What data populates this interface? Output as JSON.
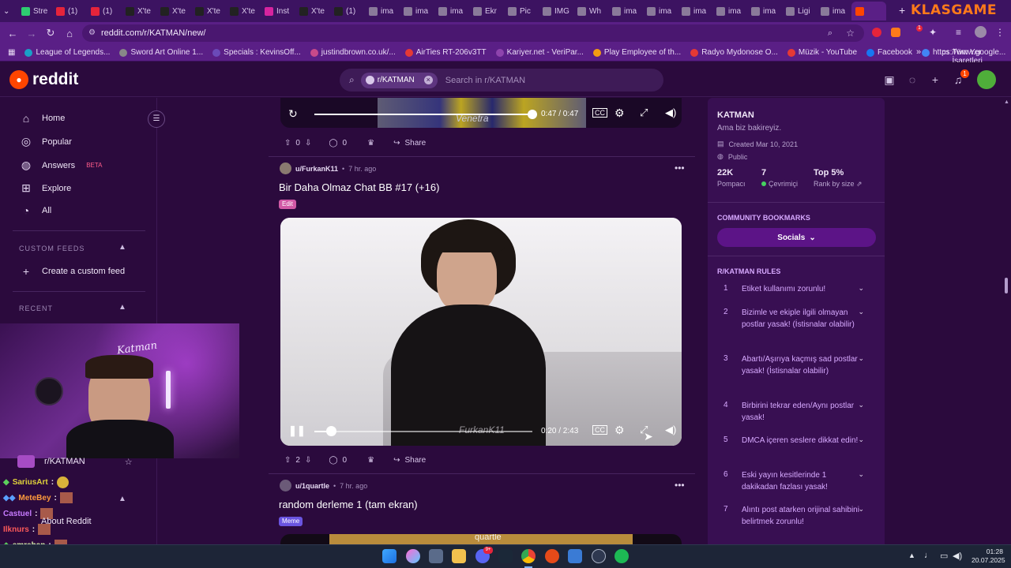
{
  "browser": {
    "tabs": [
      "Stre",
      "(1)",
      "(1)",
      "X'te",
      "X'te",
      "X'te",
      "X'te",
      "Inst",
      "X'te",
      "(1)",
      "ima",
      "ima",
      "ima",
      "Ekr",
      "Pic",
      "IMG",
      "Wh",
      "ima",
      "ima",
      "ima",
      "ima",
      "ima",
      "Ligi",
      "ima",
      ""
    ],
    "brand_text": "KLASGAME",
    "url": "reddit.com/r/KATMAN/new/",
    "bookmarks": [
      "League of Legends...",
      "Sword Art Online 1...",
      "Specials : KevinsOff...",
      "justindbrown.co.uk/...",
      "AirTies RT-206v3TT",
      "Kariyer.net - VeriPar...",
      "Play Employee of th...",
      "Radyo Mydonose O...",
      "Müzik - YouTube",
      "Facebook",
      "https://www.google..."
    ],
    "bookmarks_all": "Tüm Yer İşaretleri",
    "update_count": "1"
  },
  "reddit": {
    "logo_text": "reddit",
    "search_chip": "r/KATMAN",
    "search_placeholder": "Search in r/KATMAN",
    "notif_count": "1"
  },
  "leftnav": {
    "items": [
      {
        "label": "Home",
        "icon": "home-icon"
      },
      {
        "label": "Popular",
        "icon": "popular-icon"
      },
      {
        "label": "Answers",
        "icon": "answers-icon",
        "badge": "BETA"
      },
      {
        "label": "Explore",
        "icon": "explore-icon"
      },
      {
        "label": "All",
        "icon": "all-icon"
      }
    ],
    "custom_feeds_header": "CUSTOM FEEDS",
    "create_feed": "Create a custom feed",
    "recent_header": "RECENT",
    "recent_item": "r/KATMAN",
    "about": "About Reddit"
  },
  "overlay": {
    "cam_text": "Katman",
    "chat": [
      {
        "user": "SariusArt",
        "color": "#e0d23a"
      },
      {
        "user": "MeteBey",
        "color": "#ff9a3c"
      },
      {
        "user": "Castuel",
        "color": "#c77bff"
      },
      {
        "user": "Ilknurs",
        "color": "#ff5a5a"
      },
      {
        "user": "emrehan",
        "color": "#d6f0a8"
      }
    ]
  },
  "feed": {
    "prev_video": {
      "time": "0:47 / 0:47",
      "watermark": "Venetra",
      "progress": 1.0
    },
    "prev_actions": {
      "votes": "0",
      "comments": "0",
      "share": "Share"
    },
    "post1": {
      "author": "u/FurkanK11",
      "age": "7 hr. ago",
      "title": "Bir Daha Olmaz Chat BB #17 (+16)",
      "flair": "Edit",
      "video_time": "0:20 / 2:43",
      "video_watermark": "FurkanK11",
      "progress": 0.075,
      "votes": "2",
      "comments": "0",
      "share": "Share"
    },
    "post2": {
      "author": "u/1quartle",
      "age": "7 hr. ago",
      "title": "random derleme 1 (tam ekran)",
      "flair": "Meme",
      "video_watermark": "quartle"
    }
  },
  "community": {
    "name": "KATMAN",
    "description": "Ama biz bakireyiz.",
    "created": "Created Mar 10, 2021",
    "visibility": "Public",
    "stats": [
      {
        "value": "22K",
        "label": "Pompacı"
      },
      {
        "value": "7",
        "label": "Çevrimiçi"
      },
      {
        "value": "Top 5%",
        "label": "Rank by size"
      }
    ],
    "bookmarks_header": "COMMUNITY BOOKMARKS",
    "bookmarks_button": "Socials",
    "rules_header": "R/KATMAN RULES",
    "rules": [
      {
        "n": "1",
        "text": "Etiket kullanımı zorunlu!"
      },
      {
        "n": "2",
        "text": "Bizimle ve ekiple ilgili olmayan postlar yasak! (İstisnalar olabilir)"
      },
      {
        "n": "3",
        "text": "Abartı/Aşırıya kaçmış sad postlar yasak! (İstisnalar olabilir)"
      },
      {
        "n": "4",
        "text": "Birbirini tekrar eden/Aynı postlar yasak!"
      },
      {
        "n": "5",
        "text": "DMCA içeren seslere dikkat edin!"
      },
      {
        "n": "6",
        "text": "Eski yayın kesitlerinde 1 dakikadan fazlası yasak!"
      },
      {
        "n": "7",
        "text": "Alıntı post atarken orijinal sahibini belirtmek zorunlu!"
      }
    ]
  },
  "taskbar": {
    "time": "01:28",
    "date": "20.07.2025",
    "badge": "9+"
  }
}
